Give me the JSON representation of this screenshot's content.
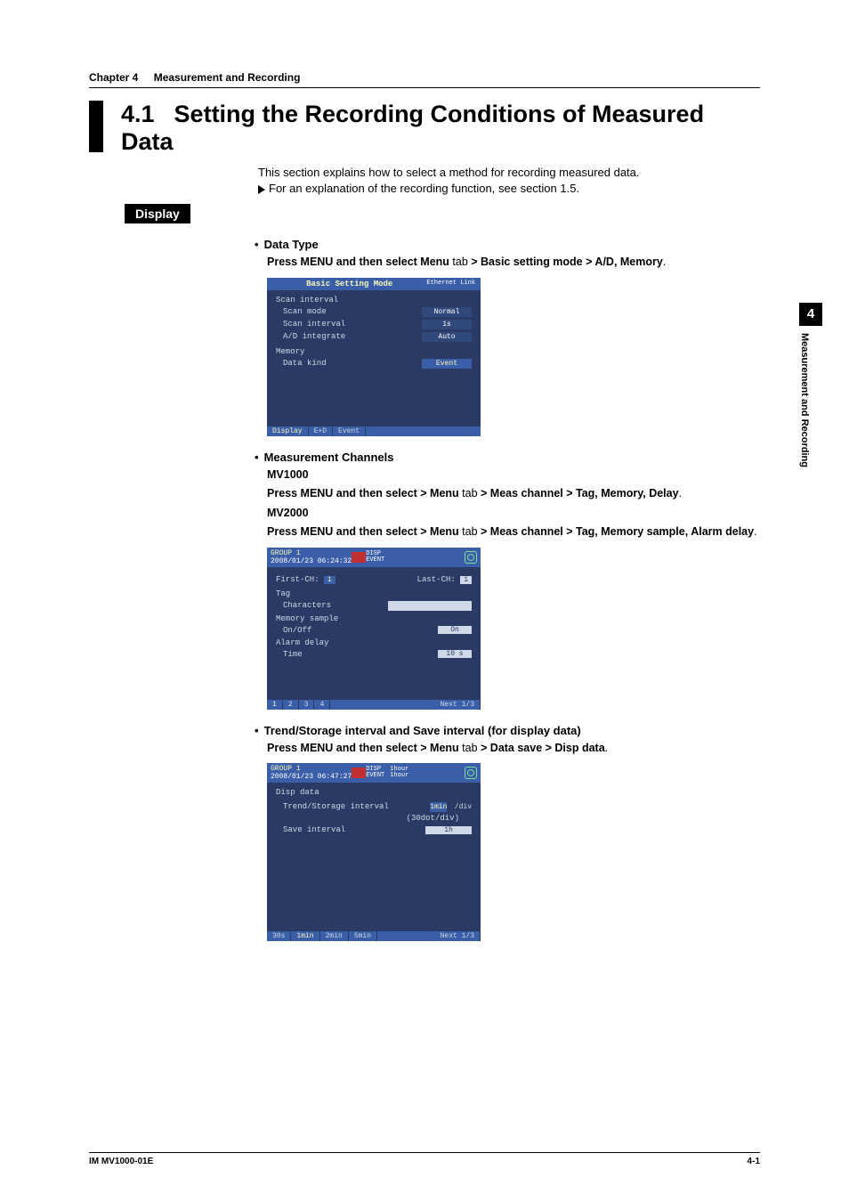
{
  "header": {
    "chapter": "Chapter 4",
    "title": "Measurement and Recording"
  },
  "section": {
    "number": "4.1",
    "title": "Setting the Recording Conditions of Measured Data",
    "intro1": "This section explains how to select a method for recording measured data.",
    "intro2": "For an explanation of the recording function, see section 1.5."
  },
  "display_tag": "Display",
  "b1": {
    "heading": "Data Type",
    "path_pre": "Press MENU and then select Menu",
    "path_tab": " tab ",
    "path_post": "> Basic setting mode > A/D, Memory",
    "shot": {
      "title": "Basic Setting Mode",
      "title_right": "Ethernet\nLink",
      "grp": "Scan interval",
      "rows": [
        {
          "label": "Scan mode",
          "val": "Normal",
          "sel": false
        },
        {
          "label": "Scan interval",
          "val": "1s",
          "sel": false
        },
        {
          "label": "A/D integrate",
          "val": "Auto",
          "sel": false
        }
      ],
      "grp2": "Memory",
      "rows2": [
        {
          "label": "Data kind",
          "val": "Event",
          "sel": true
        }
      ],
      "footer": [
        "Display",
        "E+D",
        "Event"
      ]
    }
  },
  "b2": {
    "heading": "Measurement Channels",
    "m1": "MV1000",
    "m1path_pre": "Press MENU and then select > Menu",
    "m1path_tab": " tab ",
    "m1path_post": "> Meas channel > Tag, Memory, Delay",
    "m2": "MV2000",
    "m2path_pre": "Press MENU and then select > Menu",
    "m2path_tab": " tab ",
    "m2path_post": "> Meas channel > Tag, Memory sample, Alarm delay",
    "shot": {
      "hdr_left": "GROUP 1",
      "hdr_date": "2008/01/23 06:24:32",
      "badge1": "DISP",
      "badge2": "EVENT",
      "first": "First-CH:",
      "first_v": "1",
      "last": "Last-CH:",
      "last_v": "1",
      "tag": "Tag",
      "chars": "Characters",
      "mem": "Memory sample",
      "onoff": "On/Off",
      "onoff_v": "On",
      "ad": "Alarm delay",
      "tm": "Time",
      "tm_v": "10 s",
      "footer": [
        "1",
        "2",
        "3",
        "4"
      ],
      "footer_right": "Next 1/3"
    }
  },
  "b3": {
    "heading": "Trend/Storage interval and Save interval (for display data)",
    "path_pre": "Press MENU and then select > Menu",
    "path_tab": " tab ",
    "path_post": "> Data save > Disp data",
    "shot": {
      "hdr_left": "GROUP 1",
      "hdr_date": "2008/01/23 06:47:27",
      "badge1": "DISP",
      "badge2": "EVENT",
      "rate": "1hour\n1hour",
      "title": "Disp data",
      "row1": "Trend/Storage interval",
      "row1v": "1min",
      "row1s": "/div",
      "row1note": "(30dot/div)",
      "row2": "Save interval",
      "row2v": "1h",
      "footer": [
        "30s",
        "1min",
        "2min",
        "5min"
      ],
      "footer_right": "Next 1/3"
    }
  },
  "side": {
    "num": "4",
    "label": "Measurement and Recording"
  },
  "footer": {
    "left": "IM MV1000-01E",
    "right": "4-1"
  }
}
